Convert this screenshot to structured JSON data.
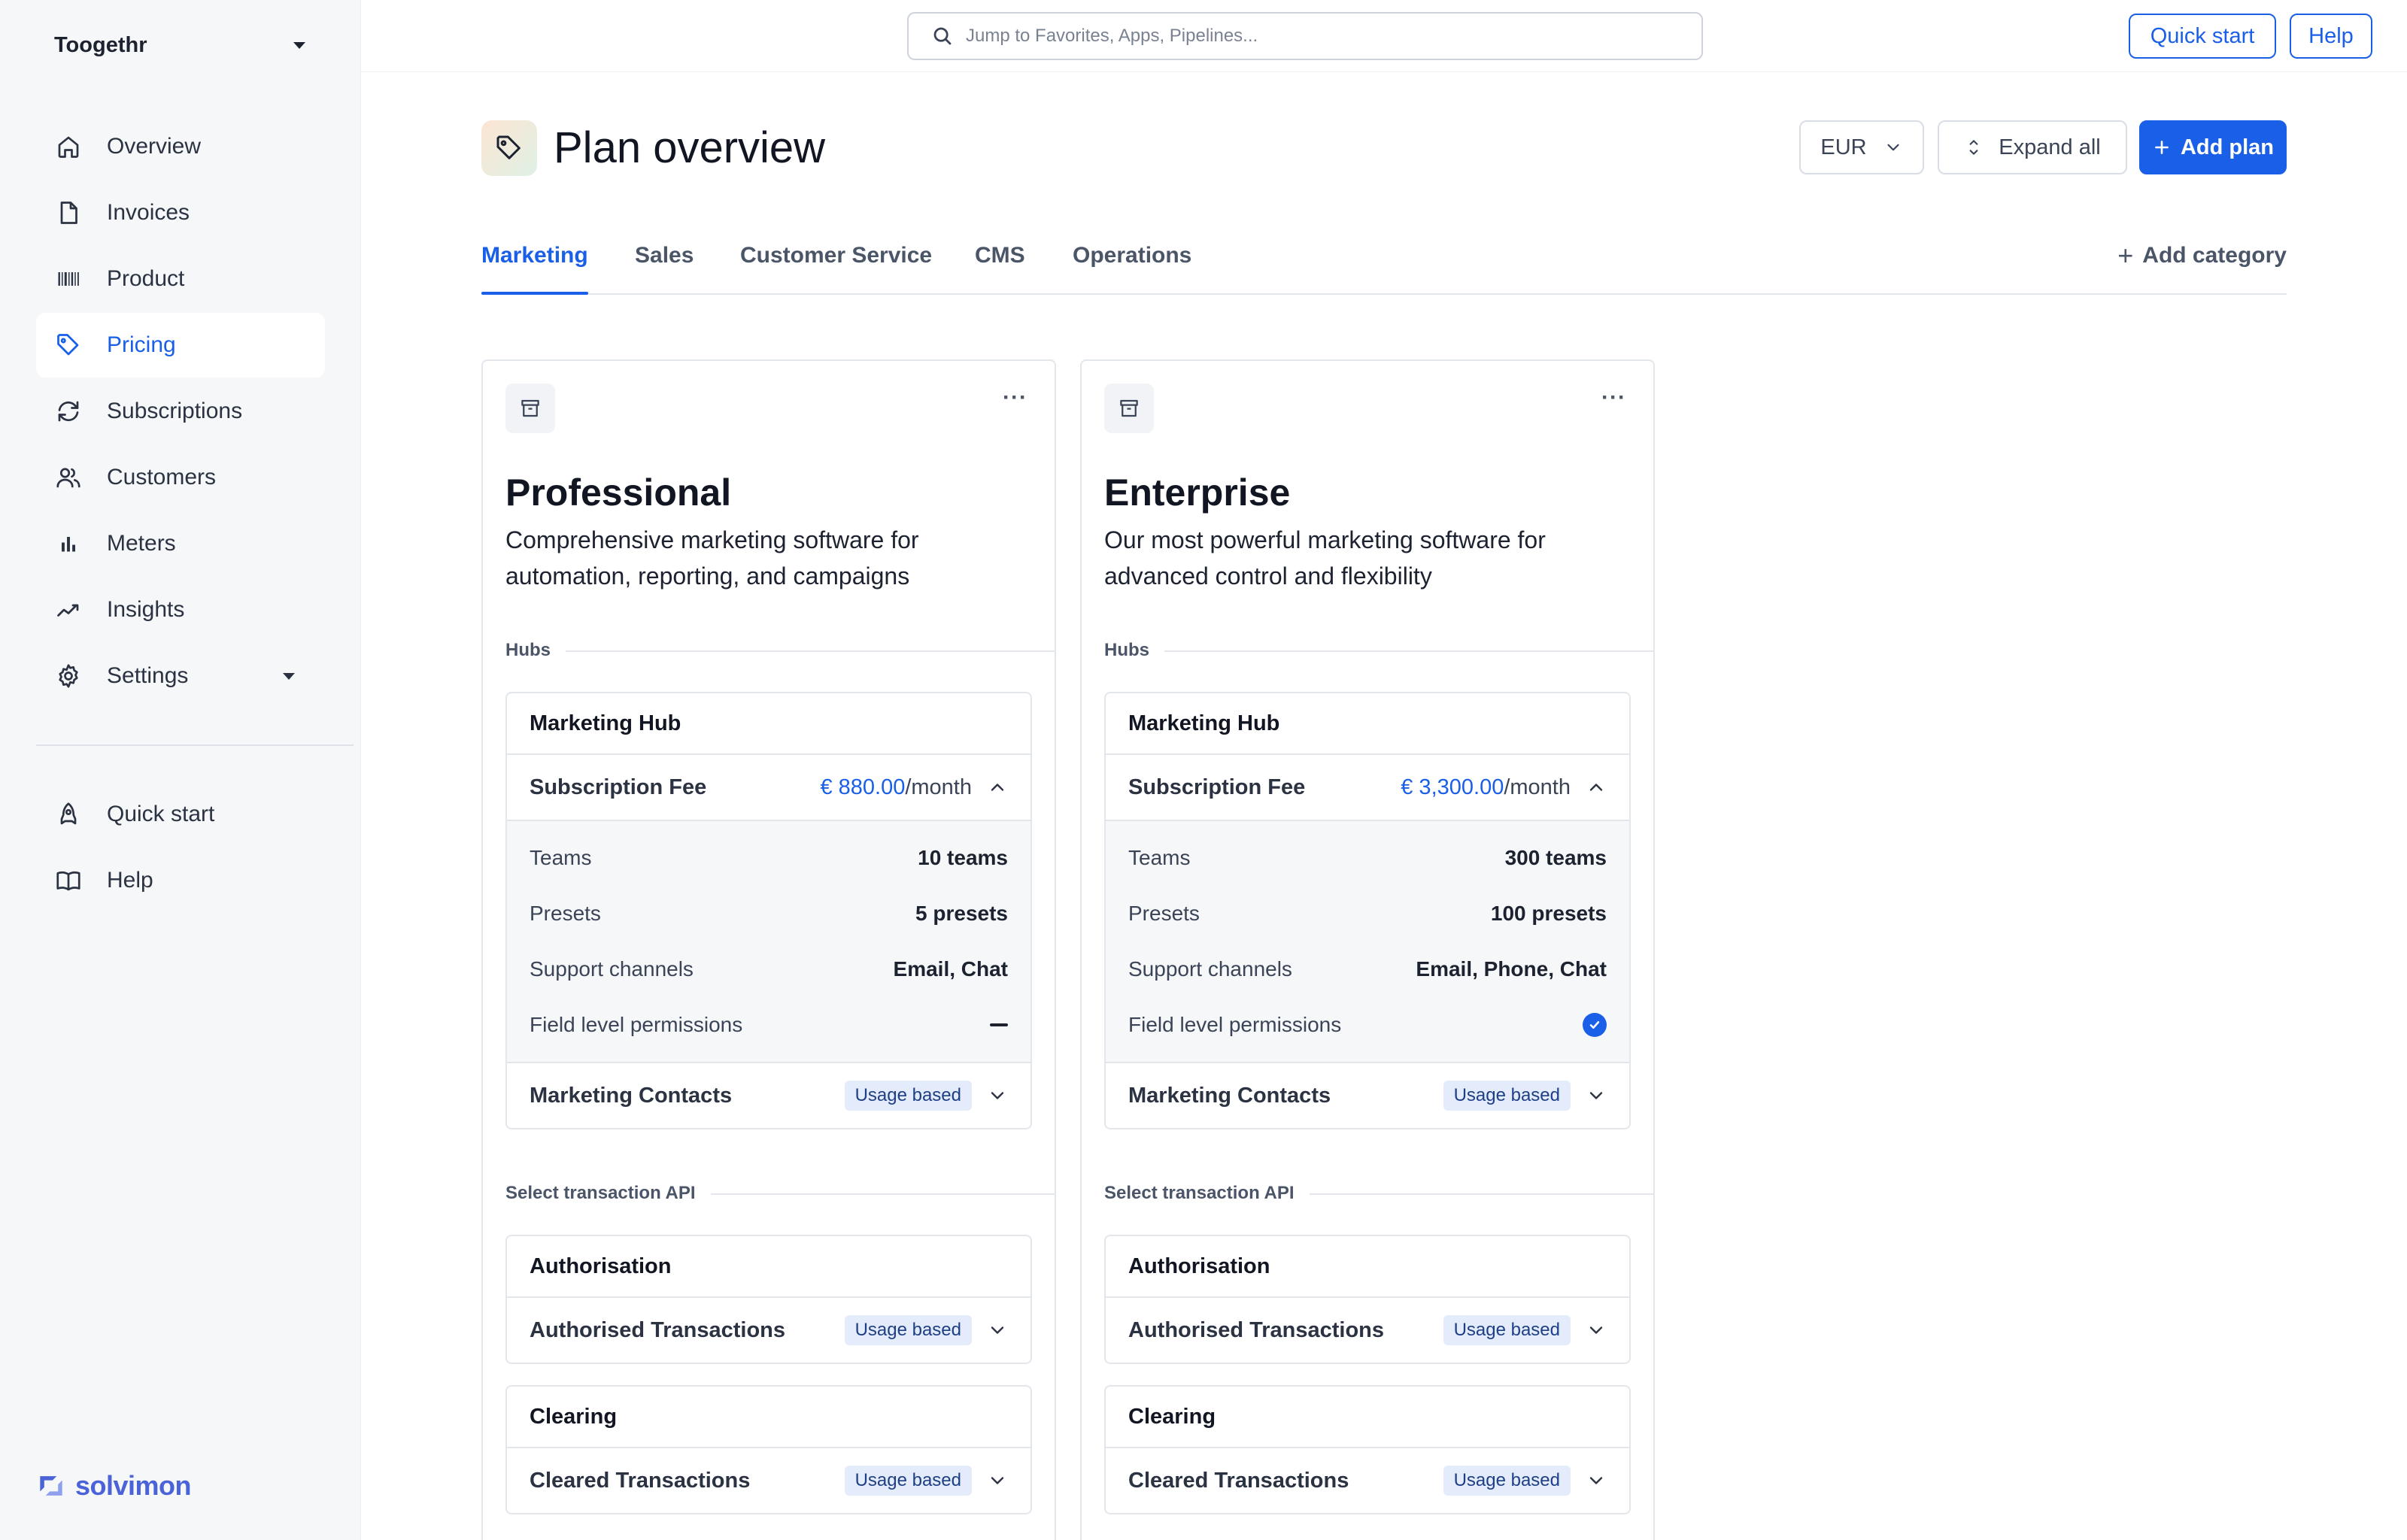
{
  "workspace": {
    "name": "Toogethr"
  },
  "nav": {
    "items": [
      {
        "label": "Overview",
        "icon": "home-icon"
      },
      {
        "label": "Invoices",
        "icon": "document-icon"
      },
      {
        "label": "Product",
        "icon": "barcode-icon"
      },
      {
        "label": "Pricing",
        "icon": "tag-icon",
        "active": true
      },
      {
        "label": "Subscriptions",
        "icon": "refresh-icon"
      },
      {
        "label": "Customers",
        "icon": "users-icon"
      },
      {
        "label": "Meters",
        "icon": "bar-chart-icon"
      },
      {
        "label": "Insights",
        "icon": "trend-icon"
      },
      {
        "label": "Settings",
        "icon": "gear-icon"
      }
    ],
    "secondary": [
      {
        "label": "Quick start",
        "icon": "rocket-icon"
      },
      {
        "label": "Help",
        "icon": "book-icon"
      }
    ]
  },
  "brand": {
    "name": "solvimon"
  },
  "topbar": {
    "search_placeholder": "Jump to Favorites, Apps, Pipelines...",
    "quick_start": "Quick start",
    "help": "Help"
  },
  "header": {
    "title": "Plan overview",
    "currency": "EUR",
    "expand_all": "Expand all",
    "add_plan": "Add plan"
  },
  "tabs": {
    "items": [
      "Marketing",
      "Sales",
      "Customer Service",
      "CMS",
      "Operations"
    ],
    "active": "Marketing",
    "add_category": "Add category"
  },
  "colors": {
    "accent": "#1a5fe8",
    "badge_bg": "#e4ecfb",
    "sidebar_bg": "#f6f7f9"
  },
  "plans": [
    {
      "name": "Professional",
      "description": "Comprehensive marketing software for automation, reporting, and campaigns",
      "hubs_label": "Hubs",
      "hub": {
        "title": "Marketing Hub",
        "fee_label": "Subscription Fee",
        "fee_price": "€ 880.00",
        "fee_period": "/month",
        "details": {
          "teams_label": "Teams",
          "teams_value": "10 teams",
          "presets_label": "Presets",
          "presets_value": "5 presets",
          "support_label": "Support channels",
          "support_value": "Email, Chat",
          "flp_label": "Field level permissions",
          "flp_included": false
        },
        "contacts_label": "Marketing Contacts",
        "contacts_badge": "Usage based"
      },
      "api_label": "Select transaction API",
      "authorisation": {
        "title": "Authorisation",
        "row": "Authorised Transactions",
        "badge": "Usage based"
      },
      "clearing": {
        "title": "Clearing",
        "row": "Cleared Transactions",
        "badge": "Usage based"
      },
      "more": "···"
    },
    {
      "name": "Enterprise",
      "description": "Our most powerful marketing software for advanced control and flexibility",
      "hubs_label": "Hubs",
      "hub": {
        "title": "Marketing Hub",
        "fee_label": "Subscription Fee",
        "fee_price": "€ 3,300.00",
        "fee_period": "/month",
        "details": {
          "teams_label": "Teams",
          "teams_value": "300 teams",
          "presets_label": "Presets",
          "presets_value": "100 presets",
          "support_label": "Support channels",
          "support_value": "Email, Phone, Chat",
          "flp_label": "Field level permissions",
          "flp_included": true
        },
        "contacts_label": "Marketing Contacts",
        "contacts_badge": "Usage based"
      },
      "api_label": "Select transaction API",
      "authorisation": {
        "title": "Authorisation",
        "row": "Authorised Transactions",
        "badge": "Usage based"
      },
      "clearing": {
        "title": "Clearing",
        "row": "Cleared Transactions",
        "badge": "Usage based"
      },
      "more": "···"
    }
  ]
}
